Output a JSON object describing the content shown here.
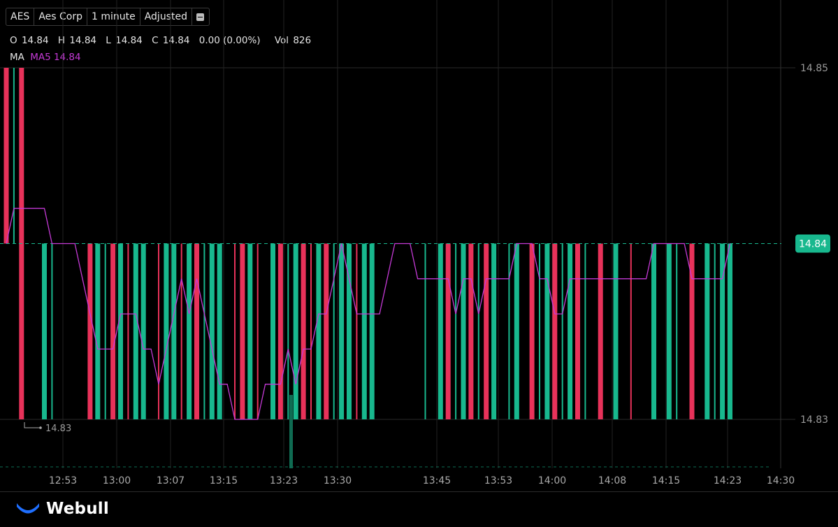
{
  "toolbar": {
    "symbol": "AES",
    "name": "Aes Corp",
    "interval": "1 minute",
    "adjustment": "Adjusted",
    "menu_icon": "list-icon"
  },
  "ohlc": {
    "o_label": "O",
    "o": "14.84",
    "h_label": "H",
    "h": "14.84",
    "l_label": "L",
    "l": "14.84",
    "c_label": "C",
    "c": "14.84",
    "change": "0.00 (0.00%)",
    "vol_label": "Vol",
    "vol": "826"
  },
  "indicator": {
    "label": "MA",
    "ma5": "MA5 14.84"
  },
  "colors": {
    "up": "#18b88e",
    "down": "#e8325a",
    "ma5": "#c53ad6",
    "grid": "#2a2a2a",
    "badge": "#18b88e"
  },
  "branding": {
    "name": "Webull"
  },
  "chart_data": {
    "type": "candlestick",
    "price_axis_labels": [
      "14.85",
      "14.83"
    ],
    "current_price": "14.84",
    "low_marker": "14.83",
    "time_labels": [
      "12:53",
      "13:00",
      "13:07",
      "13:15",
      "13:23",
      "13:30",
      "13:45",
      "13:53",
      "14:00",
      "14:08",
      "14:15",
      "14:23",
      "14:30"
    ],
    "ylim": [
      14.83,
      14.85
    ],
    "candles": [
      {
        "t": 0,
        "d": "down",
        "o": 14.85,
        "c": 14.84
      },
      {
        "t": 1,
        "d": "up",
        "o": 14.84,
        "c": 14.85
      },
      {
        "t": 2,
        "d": "down",
        "o": 14.85,
        "c": 14.83
      },
      {
        "t": 5,
        "d": "up",
        "o": 14.83,
        "c": 14.84
      },
      {
        "t": 6,
        "d": "up",
        "o": 14.83,
        "c": 14.84
      },
      {
        "t": 11,
        "d": "down",
        "o": 14.84,
        "c": 14.83
      },
      {
        "t": 12,
        "d": "up",
        "o": 14.83,
        "c": 14.84
      },
      {
        "t": 13,
        "d": "up",
        "o": 14.83,
        "c": 14.84
      },
      {
        "t": 14,
        "d": "down",
        "o": 14.84,
        "c": 14.83
      },
      {
        "t": 15,
        "d": "up",
        "o": 14.83,
        "c": 14.84
      },
      {
        "t": 16,
        "d": "down",
        "o": 14.84,
        "c": 14.83
      },
      {
        "t": 17,
        "d": "up",
        "o": 14.83,
        "c": 14.84
      },
      {
        "t": 18,
        "d": "up",
        "o": 14.83,
        "c": 14.84
      },
      {
        "t": 20,
        "d": "down",
        "o": 14.84,
        "c": 14.83
      },
      {
        "t": 21,
        "d": "up",
        "o": 14.83,
        "c": 14.84
      },
      {
        "t": 22,
        "d": "up",
        "o": 14.83,
        "c": 14.84
      },
      {
        "t": 23,
        "d": "down",
        "o": 14.84,
        "c": 14.83
      },
      {
        "t": 24,
        "d": "up",
        "o": 14.83,
        "c": 14.84
      },
      {
        "t": 25,
        "d": "down",
        "o": 14.84,
        "c": 14.83
      },
      {
        "t": 26,
        "d": "up",
        "o": 14.83,
        "c": 14.84
      },
      {
        "t": 27,
        "d": "up",
        "o": 14.83,
        "c": 14.84
      },
      {
        "t": 28,
        "d": "up",
        "o": 14.83,
        "c": 14.84
      },
      {
        "t": 30,
        "d": "down",
        "o": 14.84,
        "c": 14.83
      },
      {
        "t": 31,
        "d": "down",
        "o": 14.84,
        "c": 14.83
      },
      {
        "t": 32,
        "d": "up",
        "o": 14.83,
        "c": 14.84
      },
      {
        "t": 33,
        "d": "down",
        "o": 14.84,
        "c": 14.83
      },
      {
        "t": 35,
        "d": "up",
        "o": 14.83,
        "c": 14.84
      },
      {
        "t": 36,
        "d": "down",
        "o": 14.84,
        "c": 14.83
      },
      {
        "t": 37,
        "d": "up",
        "o": 14.83,
        "c": 14.84
      },
      {
        "t": 38,
        "d": "up",
        "o": 14.83,
        "c": 14.84
      },
      {
        "t": 39,
        "d": "down",
        "o": 14.84,
        "c": 14.83
      },
      {
        "t": 40,
        "d": "down",
        "o": 14.84,
        "c": 14.83
      },
      {
        "t": 41,
        "d": "up",
        "o": 14.83,
        "c": 14.84
      },
      {
        "t": 42,
        "d": "down",
        "o": 14.84,
        "c": 14.83
      },
      {
        "t": 43,
        "d": "up",
        "o": 14.83,
        "c": 14.84
      },
      {
        "t": 44,
        "d": "up",
        "o": 14.83,
        "c": 14.84
      },
      {
        "t": 45,
        "d": "up",
        "o": 14.83,
        "c": 14.84
      },
      {
        "t": 46,
        "d": "down",
        "o": 14.84,
        "c": 14.83
      },
      {
        "t": 47,
        "d": "up",
        "o": 14.83,
        "c": 14.84
      },
      {
        "t": 48,
        "d": "up",
        "o": 14.83,
        "c": 14.84
      },
      {
        "t": 55,
        "d": "up",
        "o": 14.83,
        "c": 14.84
      },
      {
        "t": 57,
        "d": "up",
        "o": 14.83,
        "c": 14.84
      },
      {
        "t": 58,
        "d": "down",
        "o": 14.84,
        "c": 14.83
      },
      {
        "t": 59,
        "d": "up",
        "o": 14.83,
        "c": 14.84
      },
      {
        "t": 60,
        "d": "up",
        "o": 14.83,
        "c": 14.84
      },
      {
        "t": 61,
        "d": "down",
        "o": 14.84,
        "c": 14.83
      },
      {
        "t": 62,
        "d": "up",
        "o": 14.83,
        "c": 14.84
      },
      {
        "t": 63,
        "d": "down",
        "o": 14.84,
        "c": 14.83
      },
      {
        "t": 64,
        "d": "up",
        "o": 14.83,
        "c": 14.84
      },
      {
        "t": 66,
        "d": "up",
        "o": 14.83,
        "c": 14.84
      },
      {
        "t": 67,
        "d": "up",
        "o": 14.83,
        "c": 14.84
      },
      {
        "t": 69,
        "d": "down",
        "o": 14.84,
        "c": 14.83
      },
      {
        "t": 70,
        "d": "up",
        "o": 14.83,
        "c": 14.84
      },
      {
        "t": 71,
        "d": "up",
        "o": 14.83,
        "c": 14.84
      },
      {
        "t": 72,
        "d": "down",
        "o": 14.84,
        "c": 14.83
      },
      {
        "t": 73,
        "d": "up",
        "o": 14.83,
        "c": 14.84
      },
      {
        "t": 74,
        "d": "up",
        "o": 14.83,
        "c": 14.84
      },
      {
        "t": 75,
        "d": "down",
        "o": 14.84,
        "c": 14.83
      },
      {
        "t": 76,
        "d": "up",
        "o": 14.83,
        "c": 14.84
      },
      {
        "t": 78,
        "d": "down",
        "o": 14.84,
        "c": 14.83
      },
      {
        "t": 80,
        "d": "up",
        "o": 14.83,
        "c": 14.84
      },
      {
        "t": 82,
        "d": "down",
        "o": 14.84,
        "c": 14.83
      },
      {
        "t": 85,
        "d": "up",
        "o": 14.83,
        "c": 14.84
      },
      {
        "t": 87,
        "d": "up",
        "o": 14.83,
        "c": 14.84
      },
      {
        "t": 88,
        "d": "up",
        "o": 14.83,
        "c": 14.84
      },
      {
        "t": 90,
        "d": "down",
        "o": 14.84,
        "c": 14.83
      },
      {
        "t": 92,
        "d": "up",
        "o": 14.83,
        "c": 14.84
      },
      {
        "t": 93,
        "d": "up",
        "o": 14.83,
        "c": 14.84
      },
      {
        "t": 94,
        "d": "up",
        "o": 14.83,
        "c": 14.84
      },
      {
        "t": 95,
        "d": "up",
        "o": 14.83,
        "c": 14.84
      }
    ],
    "ma5": [
      14.84,
      14.842,
      14.842,
      14.842,
      14.842,
      14.842,
      14.84,
      14.84,
      14.84,
      14.84,
      14.838,
      14.836,
      14.834,
      14.834,
      14.834,
      14.836,
      14.836,
      14.836,
      14.834,
      14.834,
      14.832,
      14.834,
      14.836,
      14.838,
      14.836,
      14.838,
      14.836,
      14.834,
      14.832,
      14.832,
      14.83,
      14.83,
      14.83,
      14.83,
      14.832,
      14.832,
      14.832,
      14.834,
      14.832,
      14.834,
      14.834,
      14.836,
      14.836,
      14.838,
      14.84,
      14.838,
      14.836,
      14.836,
      14.836,
      14.836,
      14.838,
      14.84,
      14.84,
      14.84,
      14.838,
      14.838,
      14.838,
      14.838,
      14.838,
      14.836,
      14.838,
      14.838,
      14.836,
      14.838,
      14.838,
      14.838,
      14.838,
      14.84,
      14.84,
      14.84,
      14.838,
      14.838,
      14.836,
      14.836,
      14.838,
      14.838,
      14.838,
      14.838,
      14.838,
      14.838,
      14.838,
      14.838,
      14.838,
      14.838,
      14.838,
      14.84,
      14.84,
      14.84,
      14.84,
      14.84,
      14.838,
      14.838,
      14.838,
      14.838,
      14.838,
      14.84
    ]
  }
}
